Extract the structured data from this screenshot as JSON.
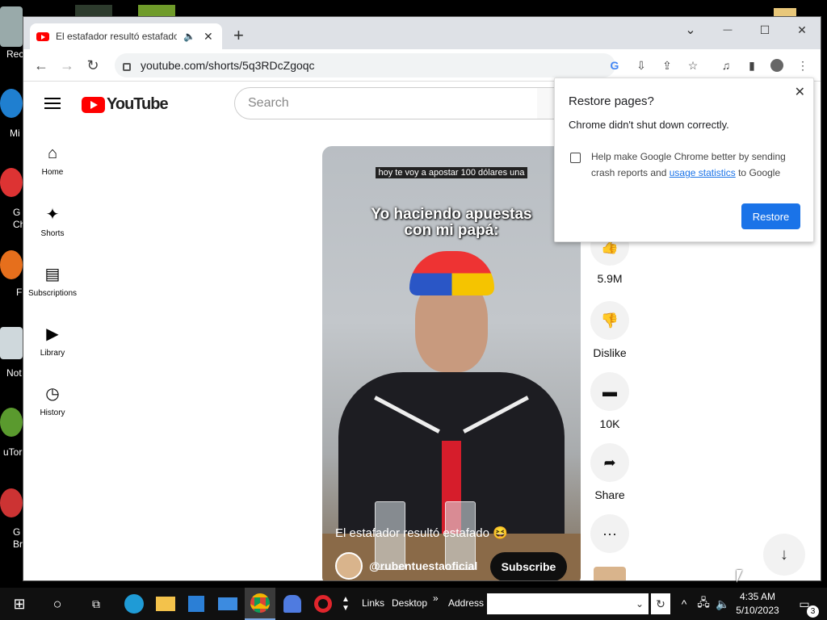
{
  "desktop": {
    "icons": [
      "Rec",
      "Mi",
      "G Ch",
      "F",
      "Not",
      "uTor",
      "G Br"
    ]
  },
  "browser": {
    "tab_title": "El estafador resultó estafado",
    "new_tab_symbol": "+",
    "url": "youtube.com/shorts/5q3RDcZgoqc",
    "window_controls": {
      "dropdown": "⌄",
      "minimize": "—",
      "maximize": "☐",
      "close": "✕"
    }
  },
  "youtube": {
    "logo_text": "YouTube",
    "search_placeholder": "Search",
    "nav": [
      {
        "label": "Home",
        "icon": "home-icon"
      },
      {
        "label": "Shorts",
        "icon": "shorts-icon"
      },
      {
        "label": "Subscriptions",
        "icon": "subscriptions-icon"
      },
      {
        "label": "Library",
        "icon": "library-icon"
      },
      {
        "label": "History",
        "icon": "history-icon"
      }
    ],
    "video": {
      "top_caption": "hoy te voy a apostar 100 dólares una",
      "big_caption_line1": "Yo haciendo apuestas",
      "big_caption_line2": "con mi papá:",
      "title": "El estafador resultó estafado 😆",
      "channel": "@rubentuestaoficial",
      "subscribe_label": "Subscribe"
    },
    "actions": [
      {
        "label": "5.9M",
        "icon": "like-icon"
      },
      {
        "label": "Dislike",
        "icon": "dislike-icon"
      },
      {
        "label": "10K",
        "icon": "comment-icon"
      },
      {
        "label": "Share",
        "icon": "share-icon"
      },
      {
        "label": "",
        "icon": "more-icon"
      }
    ]
  },
  "popup": {
    "title": "Restore pages?",
    "description": "Chrome didn't shut down correctly.",
    "checkbox_text_before": "Help make Google Chrome better by sending crash reports and ",
    "checkbox_link": "usage statistics",
    "checkbox_text_after": " to Google",
    "button_label": "Restore"
  },
  "taskbar": {
    "links_label": "Links",
    "desktop_label": "Desktop",
    "chevron": "»",
    "address_label": "Address",
    "time": "4:35 AM",
    "date": "5/10/2023",
    "notification_count": "3"
  }
}
